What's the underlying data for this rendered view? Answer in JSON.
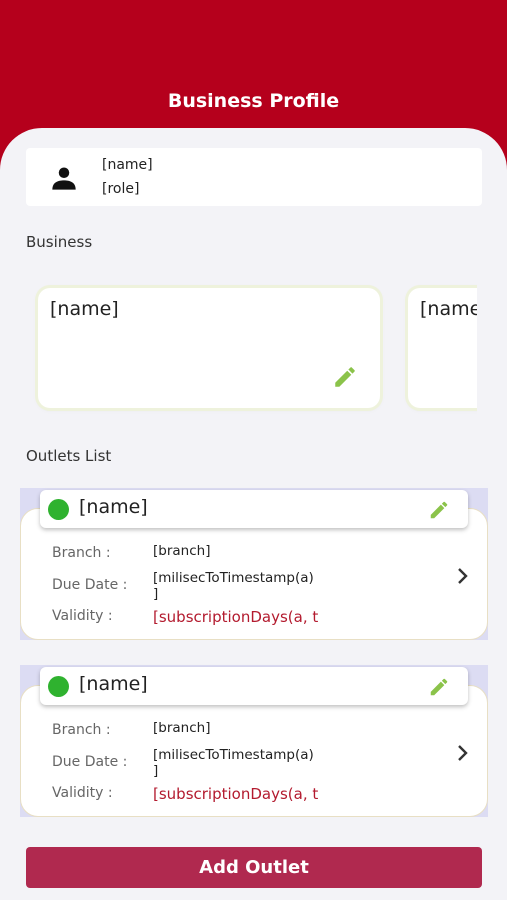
{
  "header": {
    "title": "Business Profile"
  },
  "user": {
    "icon": "person-icon",
    "name": "[name]",
    "role": "[role]"
  },
  "business": {
    "section_title": "Business",
    "cards": [
      {
        "name": "[name]",
        "edit_icon": "pencil-icon"
      },
      {
        "name": "[name]"
      }
    ]
  },
  "outlets": {
    "section_title": "Outlets List",
    "items": [
      {
        "name": "[name]",
        "status_color": "#2fb22f",
        "branch_label": "Branch :",
        "branch": "[branch]",
        "due_label": "Due Date :",
        "due_line1": "[milisecToTimestamp(a)",
        "due_line2": "]",
        "validity_label": "Validity :",
        "validity": "[subscriptionDays(a, t"
      },
      {
        "name": "[name]",
        "status_color": "#2fb22f",
        "branch_label": "Branch :",
        "branch": "[branch]",
        "due_label": "Due Date :",
        "due_line1": "[milisecToTimestamp(a)",
        "due_line2": "]",
        "validity_label": "Validity :",
        "validity": "[subscriptionDays(a, t"
      }
    ]
  },
  "add_button": {
    "label": "Add Outlet"
  },
  "colors": {
    "brand": "#b5001c",
    "button": "#b0294f",
    "edit_icon": "#8bc34a",
    "validity": "#b31a2e"
  }
}
